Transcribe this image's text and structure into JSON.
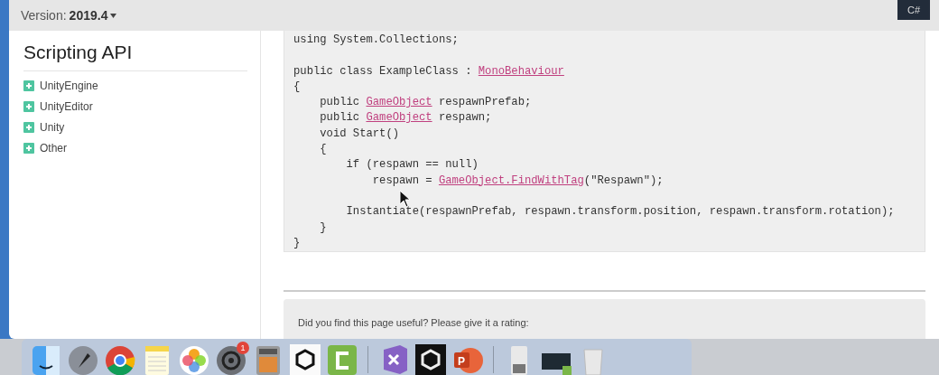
{
  "top_bar": {
    "version_label": "Version: **2019.4**",
    "language_button": "C#"
  },
  "sidebar": {
    "title": "Scripting API",
    "items": [
      {
        "label": "UnityEngine",
        "expanded": false
      },
      {
        "label": "UnityEditor",
        "expanded": false
      },
      {
        "label": "Unity",
        "expanded": false
      },
      {
        "label": "Other",
        "expanded": false
      }
    ]
  },
  "code": {
    "lines": [
      {
        "kind": "code",
        "segments": [
          {
            "text": "using System.Collections;",
            "link": false
          }
        ]
      },
      {
        "kind": "blank"
      },
      {
        "kind": "code",
        "segments": [
          {
            "text": "public class ExampleClass : ",
            "link": false
          },
          {
            "text": "MonoBehaviour",
            "link": true
          }
        ]
      },
      {
        "kind": "code",
        "segments": [
          {
            "text": "{",
            "link": false
          }
        ]
      },
      {
        "kind": "code",
        "segments": [
          {
            "text": "    public ",
            "link": false
          },
          {
            "text": "GameObject",
            "link": true
          },
          {
            "text": " respawnPrefab;",
            "link": false
          }
        ]
      },
      {
        "kind": "code",
        "segments": [
          {
            "text": "    public ",
            "link": false
          },
          {
            "text": "GameObject",
            "link": true
          },
          {
            "text": " respawn;",
            "link": false
          }
        ]
      },
      {
        "kind": "code",
        "segments": [
          {
            "text": "    void Start()",
            "link": false
          }
        ]
      },
      {
        "kind": "code",
        "segments": [
          {
            "text": "    {",
            "link": false
          }
        ]
      },
      {
        "kind": "code",
        "segments": [
          {
            "text": "        if (respawn == null)",
            "link": false
          }
        ]
      },
      {
        "kind": "code",
        "segments": [
          {
            "text": "            respawn = ",
            "link": false
          },
          {
            "text": "GameObject.FindWithTag",
            "link": true
          },
          {
            "text": "(\"Respawn\");",
            "link": false
          }
        ]
      },
      {
        "kind": "blank"
      },
      {
        "kind": "code",
        "segments": [
          {
            "text": "        Instantiate(respawnPrefab, respawn.transform.position, respawn.transform.rotation);",
            "link": false
          }
        ]
      },
      {
        "kind": "code",
        "segments": [
          {
            "text": "    }",
            "link": false
          }
        ]
      },
      {
        "kind": "code",
        "segments": [
          {
            "text": "}",
            "link": false
          }
        ]
      }
    ]
  },
  "feedback": {
    "prompt": "Did you find this page useful? Please give it a rating:"
  },
  "dock": {
    "apps": [
      {
        "kind": "finder"
      },
      {
        "kind": "rocket"
      },
      {
        "kind": "browser"
      },
      {
        "kind": "notes"
      },
      {
        "kind": "photos"
      },
      {
        "kind": "settings",
        "badge": "1"
      },
      {
        "kind": "calculator"
      },
      {
        "kind": "unity-light"
      },
      {
        "kind": "camtasia"
      },
      {
        "kind": "separator"
      },
      {
        "kind": "visual-studio"
      },
      {
        "kind": "unity-dark"
      },
      {
        "kind": "powerpoint",
        "label": "P"
      },
      {
        "kind": "separator"
      },
      {
        "kind": "preview"
      },
      {
        "kind": "terminal"
      },
      {
        "kind": "trash"
      }
    ]
  }
}
